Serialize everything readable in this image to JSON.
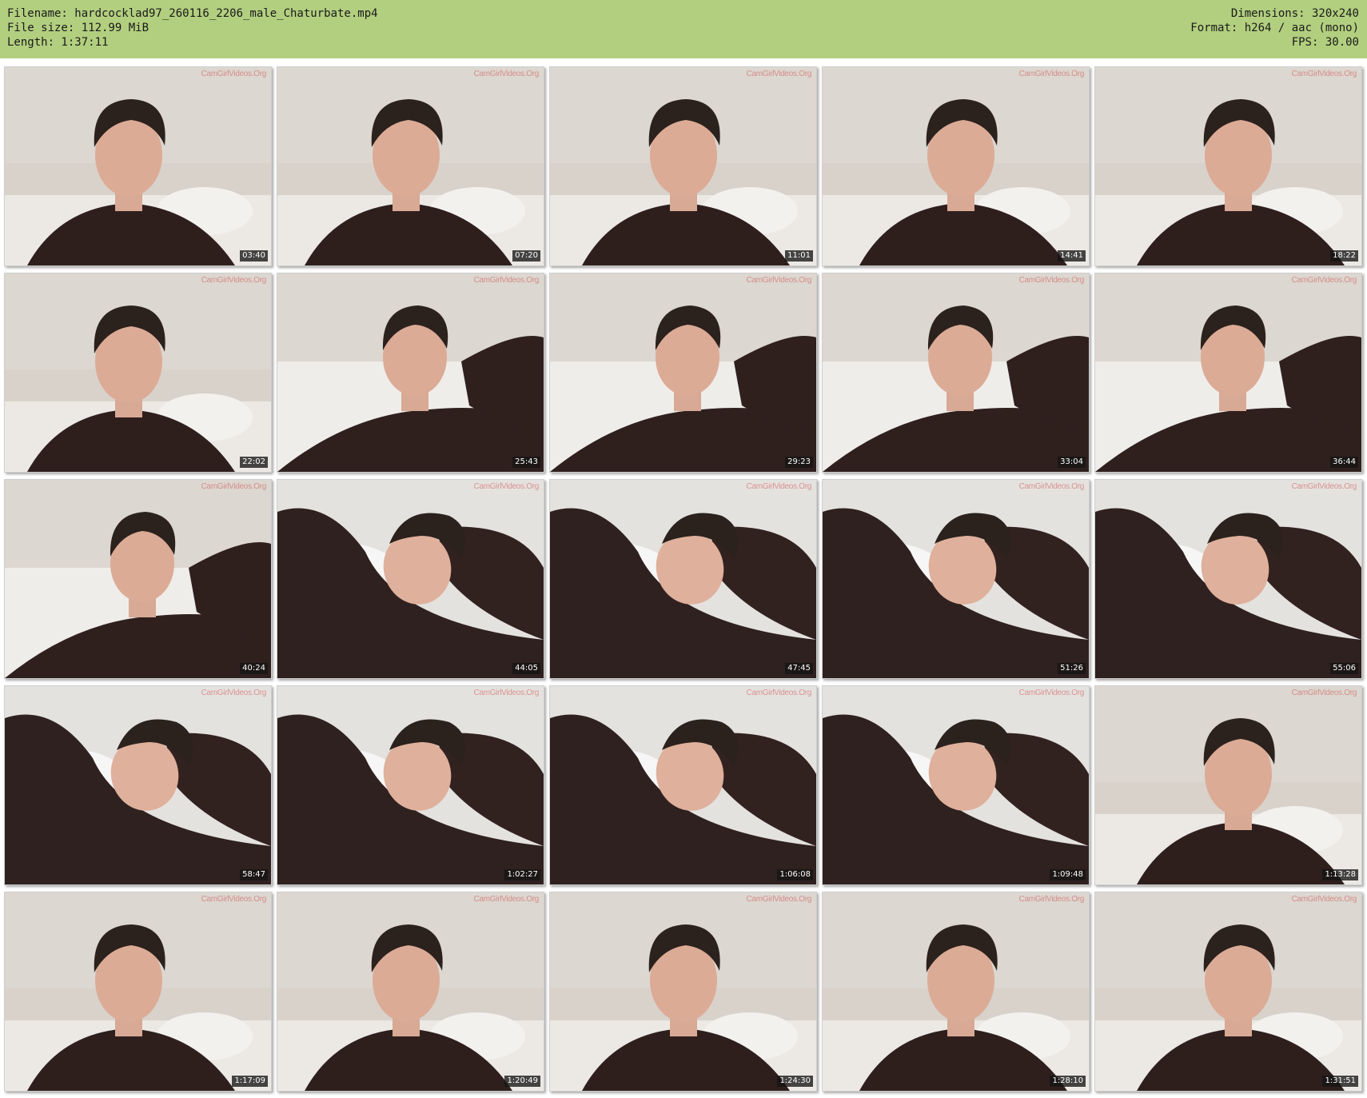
{
  "header": {
    "filename_label": "Filename: hardcocklad97_260116_2206_male_Chaturbate.mp4",
    "filesize_label": "File size: 112.99 MiB",
    "length_label": "Length: 1:37:11",
    "dimensions_label": "Dimensions: 320x240",
    "format_label": "Format: h264 / aac (mono)",
    "fps_label": "FPS: 30.00",
    "background_color": "#b2cf7f"
  },
  "watermark_text": "CamGirlVideos.Org",
  "thumbnails": [
    {
      "time": "03:40",
      "scene": "sitting"
    },
    {
      "time": "07:20",
      "scene": "sitting"
    },
    {
      "time": "11:01",
      "scene": "sitting"
    },
    {
      "time": "14:41",
      "scene": "sitting"
    },
    {
      "time": "18:22",
      "scene": "sitting"
    },
    {
      "time": "22:02",
      "scene": "sitting"
    },
    {
      "time": "25:43",
      "scene": "reclining"
    },
    {
      "time": "29:23",
      "scene": "reclining"
    },
    {
      "time": "33:04",
      "scene": "reclining"
    },
    {
      "time": "36:44",
      "scene": "reclining"
    },
    {
      "time": "40:24",
      "scene": "reclining"
    },
    {
      "time": "44:05",
      "scene": "lying"
    },
    {
      "time": "47:45",
      "scene": "lying"
    },
    {
      "time": "51:26",
      "scene": "lying"
    },
    {
      "time": "55:06",
      "scene": "lying"
    },
    {
      "time": "58:47",
      "scene": "lying"
    },
    {
      "time": "1:02:27",
      "scene": "lying"
    },
    {
      "time": "1:06:08",
      "scene": "lying"
    },
    {
      "time": "1:09:48",
      "scene": "lying"
    },
    {
      "time": "1:13:28",
      "scene": "sitting"
    },
    {
      "time": "1:17:09",
      "scene": "sitting"
    },
    {
      "time": "1:20:49",
      "scene": "sitting"
    },
    {
      "time": "1:24:30",
      "scene": "sitting"
    },
    {
      "time": "1:28:10",
      "scene": "sitting"
    },
    {
      "time": "1:31:51",
      "scene": "sitting"
    }
  ]
}
